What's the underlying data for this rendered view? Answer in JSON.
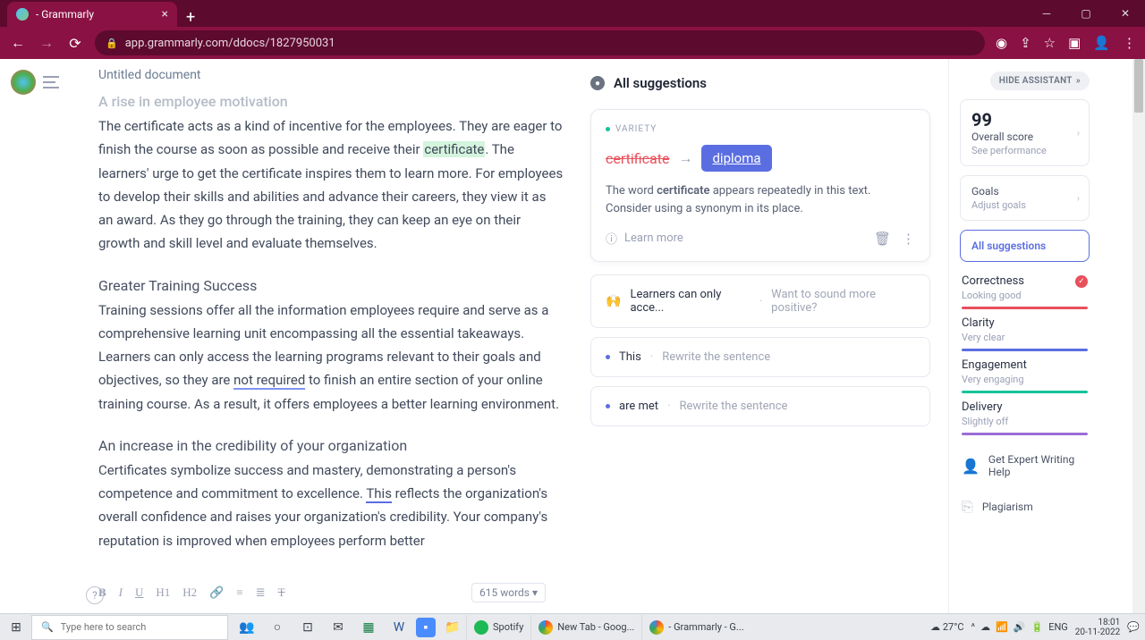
{
  "browser": {
    "tab_title": "- Grammarly",
    "url": "app.grammarly.com/ddocs/1827950031"
  },
  "doc": {
    "title": "Untitled document",
    "cut_heading": "A rise in employee motivation",
    "p1a": "The certificate acts as a kind of incentive for the employees. They are eager to finish the course as soon as possible and receive their ",
    "p1_hl": "certificate",
    "p1b": ". The learners' urge to get the certificate inspires them to learn more. For employees to develop their skills and abilities and advance their careers, they view it as an award. As they go through the training, they can keep an eye on their growth and skill level and evaluate themselves.",
    "h2": "Greater Training Success",
    "p2a": "Training sessions offer all the information employees require and serve as a comprehensive learning unit encompassing all the essential takeaways. Learners can only access the learning programs relevant to their goals and objectives, so they are ",
    "p2_ul": "not required",
    "p2b": " to finish an entire section of your online training course. As a result, it offers employees a better learning environment.",
    "h3": "An increase in the credibility of your organization",
    "p3a": "Certificates symbolize success and mastery, demonstrating a person's competence and commitment to excellence. ",
    "p3_ul": "This",
    "p3b": " reflects the organization's overall confidence and raises your organization's credibility. Your company's reputation is improved when employees perform better",
    "word_count": "615 words"
  },
  "sugg": {
    "header": "All suggestions",
    "card": {
      "tag": "VARIETY",
      "from": "certificate",
      "to": "diploma",
      "desc1": "The word ",
      "desc_bold": "certificate",
      "desc2": " appears repeatedly in this text. Consider using a synonym in its place.",
      "learn": "Learn more"
    },
    "items": [
      {
        "emoji": "🙌",
        "text": "Learners can only acce...",
        "hint": "Want to sound more positive?"
      },
      {
        "dot": true,
        "text": "This",
        "hint": "Rewrite the sentence"
      },
      {
        "dot": true,
        "text": "are met",
        "hint": "Rewrite the sentence"
      }
    ]
  },
  "right": {
    "hide": "HIDE ASSISTANT",
    "score": "99",
    "score_lbl": "Overall score",
    "score_sub": "See performance",
    "goals": "Goals",
    "goals_sub": "Adjust goals",
    "all": "All suggestions",
    "metrics": [
      {
        "name": "Correctness",
        "val": "Looking good",
        "color": "#e8505b",
        "check": true
      },
      {
        "name": "Clarity",
        "val": "Very clear",
        "color": "#5b6ee1"
      },
      {
        "name": "Engagement",
        "val": "Very engaging",
        "color": "#15c39a"
      },
      {
        "name": "Delivery",
        "val": "Slightly off",
        "color": "#9b6dd7"
      }
    ],
    "expert": "Get Expert Writing Help",
    "plag": "Plagiarism"
  },
  "taskbar": {
    "search_ph": "Type here to search",
    "spotify": "Spotify",
    "tab1": "New Tab - Goog...",
    "tab2": "- Grammarly - G...",
    "weather": "27°C",
    "lang": "ENG",
    "time": "18:01",
    "date": "20-11-2022"
  }
}
